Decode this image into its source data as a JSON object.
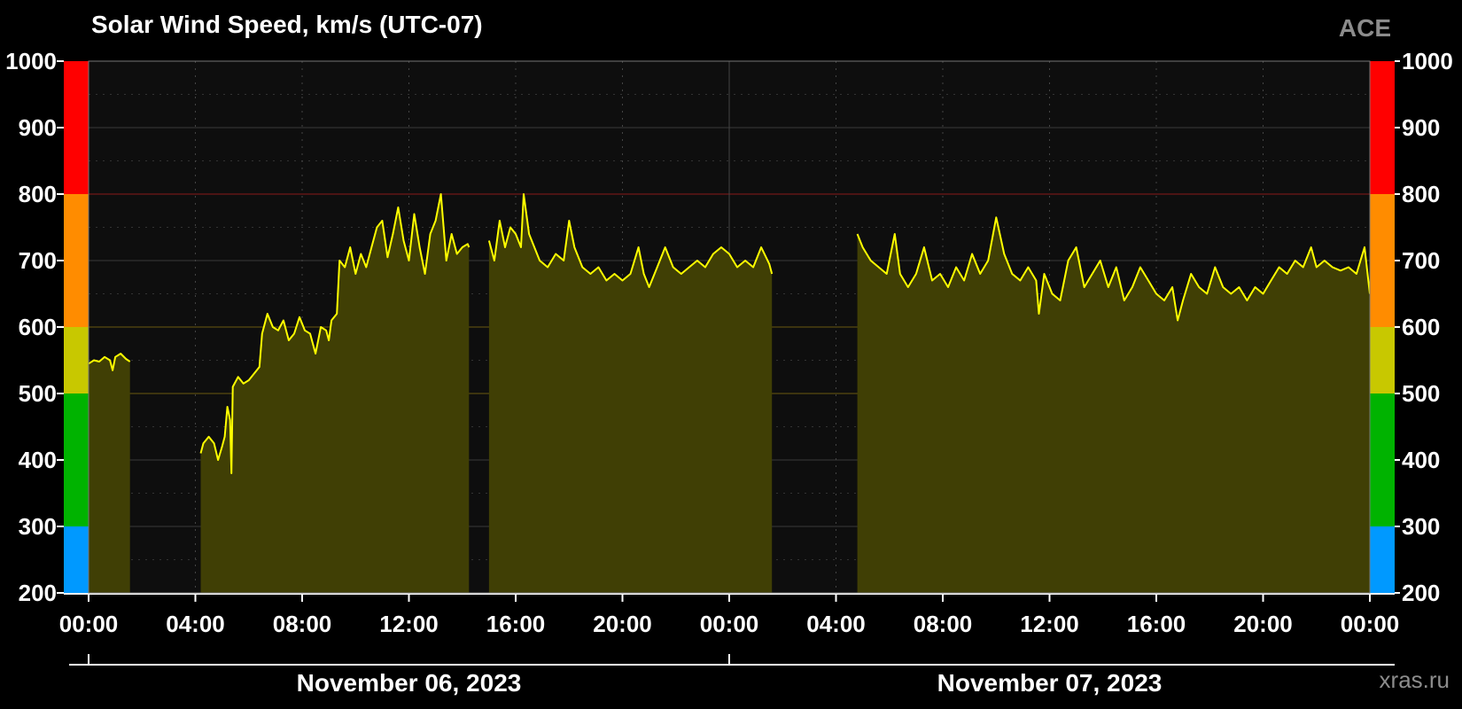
{
  "header": {
    "title": "Solar Wind Speed, km/s (UTC-07)",
    "source": "ACE"
  },
  "footer": {
    "credit": "xras.ru"
  },
  "colors": {
    "background": "#000000",
    "plot_bg": "#0e0e0e",
    "line": "#ffff00",
    "fill": "#403f05",
    "bands": {
      "blue": "#0099ff",
      "green": "#00b300",
      "yellowgreen": "#c8c800",
      "orange": "#ff8c00",
      "red": "#ff0000"
    }
  },
  "chart_data": {
    "type": "area",
    "ylim": [
      200,
      1000
    ],
    "y_ticks": [
      "200",
      "300",
      "400",
      "500",
      "600",
      "700",
      "800",
      "900",
      "1000"
    ],
    "x_ticks_hours": [
      0,
      4,
      8,
      12,
      16,
      20,
      24,
      28,
      32,
      36,
      40,
      44,
      48
    ],
    "x_tick_labels": [
      "00:00",
      "04:00",
      "08:00",
      "12:00",
      "16:00",
      "20:00",
      "00:00",
      "04:00",
      "08:00",
      "12:00",
      "16:00",
      "20:00",
      "00:00"
    ],
    "dates": [
      {
        "label": "November 06, 2023",
        "start_hour": 0,
        "end_hour": 24
      },
      {
        "label": "November 07, 2023",
        "start_hour": 24,
        "end_hour": 48
      }
    ],
    "speed_bands": [
      {
        "from": 200,
        "to": 300,
        "color": "blue"
      },
      {
        "from": 300,
        "to": 500,
        "color": "green"
      },
      {
        "from": 500,
        "to": 600,
        "color": "yellowgreen"
      },
      {
        "from": 600,
        "to": 800,
        "color": "orange"
      },
      {
        "from": 800,
        "to": 1000,
        "color": "red"
      }
    ],
    "series": [
      {
        "segments": [
          [
            [
              0.0,
              545
            ],
            [
              0.2,
              550
            ],
            [
              0.4,
              548
            ],
            [
              0.6,
              555
            ],
            [
              0.8,
              550
            ],
            [
              0.9,
              535
            ],
            [
              1.0,
              555
            ],
            [
              1.2,
              560
            ],
            [
              1.4,
              552
            ],
            [
              1.55,
              548
            ]
          ],
          [
            [
              4.2,
              410
            ],
            [
              4.3,
              425
            ],
            [
              4.5,
              435
            ],
            [
              4.7,
              425
            ],
            [
              4.85,
              400
            ],
            [
              5.0,
              420
            ],
            [
              5.1,
              435
            ],
            [
              5.2,
              480
            ],
            [
              5.3,
              460
            ],
            [
              5.35,
              380
            ],
            [
              5.4,
              510
            ],
            [
              5.6,
              525
            ],
            [
              5.8,
              515
            ],
            [
              6.0,
              520
            ],
            [
              6.2,
              530
            ],
            [
              6.4,
              540
            ],
            [
              6.5,
              590
            ],
            [
              6.7,
              620
            ],
            [
              6.9,
              600
            ],
            [
              7.1,
              595
            ],
            [
              7.3,
              610
            ],
            [
              7.5,
              580
            ],
            [
              7.7,
              590
            ],
            [
              7.9,
              615
            ],
            [
              8.1,
              595
            ],
            [
              8.3,
              590
            ],
            [
              8.5,
              560
            ],
            [
              8.7,
              600
            ],
            [
              8.9,
              595
            ],
            [
              9.0,
              580
            ],
            [
              9.1,
              610
            ],
            [
              9.3,
              620
            ],
            [
              9.4,
              700
            ],
            [
              9.6,
              690
            ],
            [
              9.8,
              720
            ],
            [
              10.0,
              680
            ],
            [
              10.2,
              710
            ],
            [
              10.4,
              690
            ],
            [
              10.6,
              720
            ],
            [
              10.8,
              750
            ],
            [
              11.0,
              760
            ],
            [
              11.2,
              705
            ],
            [
              11.4,
              740
            ],
            [
              11.6,
              780
            ],
            [
              11.8,
              730
            ],
            [
              12.0,
              700
            ],
            [
              12.2,
              770
            ],
            [
              12.4,
              720
            ],
            [
              12.6,
              680
            ],
            [
              12.8,
              740
            ],
            [
              13.0,
              760
            ],
            [
              13.2,
              800
            ],
            [
              13.4,
              700
            ],
            [
              13.6,
              740
            ],
            [
              13.8,
              710
            ],
            [
              14.0,
              720
            ],
            [
              14.2,
              725
            ],
            [
              14.25,
              720
            ]
          ],
          [
            [
              15.0,
              730
            ],
            [
              15.2,
              700
            ],
            [
              15.4,
              760
            ],
            [
              15.6,
              720
            ],
            [
              15.8,
              750
            ],
            [
              16.0,
              740
            ],
            [
              16.2,
              720
            ],
            [
              16.3,
              800
            ],
            [
              16.5,
              740
            ],
            [
              16.7,
              720
            ],
            [
              16.9,
              700
            ],
            [
              17.2,
              690
            ],
            [
              17.5,
              710
            ],
            [
              17.8,
              700
            ],
            [
              18.0,
              760
            ],
            [
              18.2,
              720
            ],
            [
              18.5,
              690
            ],
            [
              18.8,
              680
            ],
            [
              19.1,
              690
            ],
            [
              19.4,
              670
            ],
            [
              19.7,
              680
            ],
            [
              20.0,
              670
            ],
            [
              20.3,
              680
            ],
            [
              20.6,
              720
            ],
            [
              20.8,
              680
            ],
            [
              21.0,
              660
            ],
            [
              21.3,
              690
            ],
            [
              21.6,
              720
            ],
            [
              21.9,
              690
            ],
            [
              22.2,
              680
            ],
            [
              22.5,
              690
            ],
            [
              22.8,
              700
            ],
            [
              23.1,
              690
            ],
            [
              23.4,
              710
            ],
            [
              23.7,
              720
            ],
            [
              24.0,
              710
            ],
            [
              24.3,
              690
            ],
            [
              24.6,
              700
            ],
            [
              24.9,
              690
            ],
            [
              25.2,
              720
            ],
            [
              25.5,
              695
            ],
            [
              25.6,
              680
            ]
          ],
          [
            [
              28.8,
              740
            ],
            [
              29.0,
              720
            ],
            [
              29.3,
              700
            ],
            [
              29.6,
              690
            ],
            [
              29.9,
              680
            ],
            [
              30.2,
              740
            ],
            [
              30.4,
              680
            ],
            [
              30.7,
              660
            ],
            [
              31.0,
              680
            ],
            [
              31.3,
              720
            ],
            [
              31.6,
              670
            ],
            [
              31.9,
              680
            ],
            [
              32.2,
              660
            ],
            [
              32.5,
              690
            ],
            [
              32.8,
              670
            ],
            [
              33.1,
              710
            ],
            [
              33.4,
              680
            ],
            [
              33.7,
              700
            ],
            [
              34.0,
              765
            ],
            [
              34.3,
              710
            ],
            [
              34.6,
              680
            ],
            [
              34.9,
              670
            ],
            [
              35.2,
              690
            ],
            [
              35.5,
              670
            ],
            [
              35.6,
              620
            ],
            [
              35.8,
              680
            ],
            [
              36.1,
              650
            ],
            [
              36.4,
              640
            ],
            [
              36.7,
              700
            ],
            [
              37.0,
              720
            ],
            [
              37.3,
              660
            ],
            [
              37.6,
              680
            ],
            [
              37.9,
              700
            ],
            [
              38.2,
              660
            ],
            [
              38.5,
              690
            ],
            [
              38.8,
              640
            ],
            [
              39.1,
              660
            ],
            [
              39.4,
              690
            ],
            [
              39.7,
              670
            ],
            [
              40.0,
              650
            ],
            [
              40.3,
              640
            ],
            [
              40.6,
              660
            ],
            [
              40.8,
              610
            ],
            [
              41.0,
              640
            ],
            [
              41.3,
              680
            ],
            [
              41.6,
              660
            ],
            [
              41.9,
              650
            ],
            [
              42.2,
              690
            ],
            [
              42.5,
              660
            ],
            [
              42.8,
              650
            ],
            [
              43.1,
              660
            ],
            [
              43.4,
              640
            ],
            [
              43.7,
              660
            ],
            [
              44.0,
              650
            ],
            [
              44.3,
              670
            ],
            [
              44.6,
              690
            ],
            [
              44.9,
              680
            ],
            [
              45.2,
              700
            ],
            [
              45.5,
              690
            ],
            [
              45.8,
              720
            ],
            [
              46.0,
              690
            ],
            [
              46.3,
              700
            ],
            [
              46.6,
              690
            ],
            [
              46.9,
              685
            ],
            [
              47.2,
              690
            ],
            [
              47.5,
              680
            ],
            [
              47.8,
              720
            ],
            [
              48.0,
              650
            ]
          ]
        ]
      }
    ]
  }
}
